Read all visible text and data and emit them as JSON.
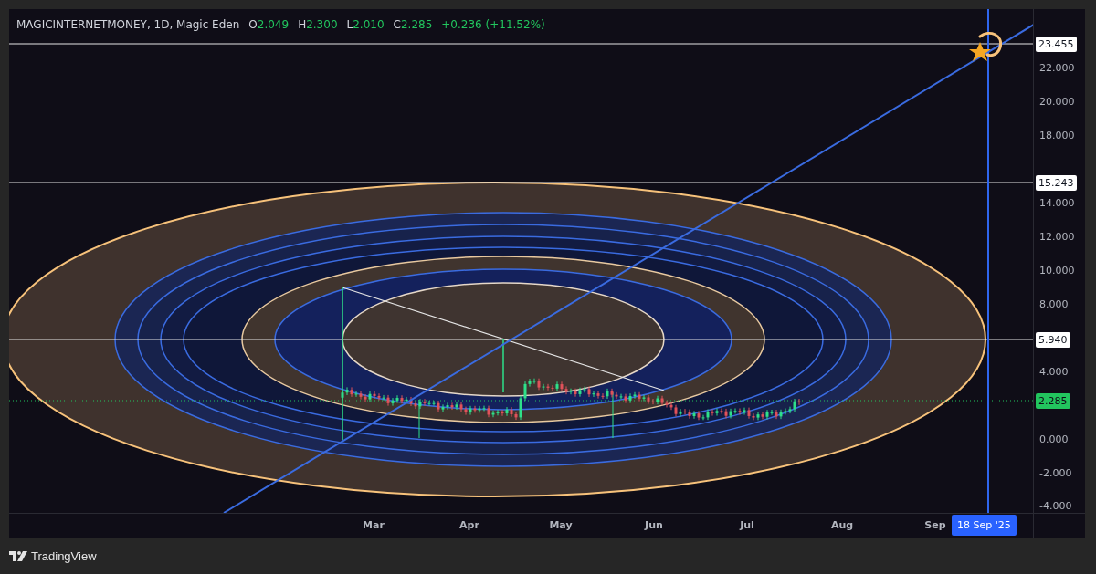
{
  "header": {
    "symbol": "MAGICINTERNETMONEY, 1D, Magic Eden",
    "ohlc": [
      {
        "label": "O",
        "value": "2.049"
      },
      {
        "label": "H",
        "value": "2.300"
      },
      {
        "label": "L",
        "value": "2.010"
      },
      {
        "label": "C",
        "value": "2.285"
      }
    ],
    "change": "+0.236 (+11.52%)"
  },
  "price_axis": {
    "ticks": [
      "22.000",
      "20.000",
      "18.000",
      "14.000",
      "12.000",
      "10.000",
      "8.000",
      "4.000",
      "0.000",
      "-2.000",
      "-4.000"
    ]
  },
  "price_labels": [
    {
      "value": "23.455",
      "kind": "level"
    },
    {
      "value": "15.243",
      "kind": "level"
    },
    {
      "value": "5.940",
      "kind": "level"
    },
    {
      "value": "2.285",
      "kind": "last"
    }
  ],
  "time_axis": {
    "labels": [
      "Mar",
      "Apr",
      "May",
      "Jun",
      "Jul",
      "Aug",
      "Sep"
    ],
    "marker": "18 Sep '25"
  },
  "brand": "TradingView"
}
